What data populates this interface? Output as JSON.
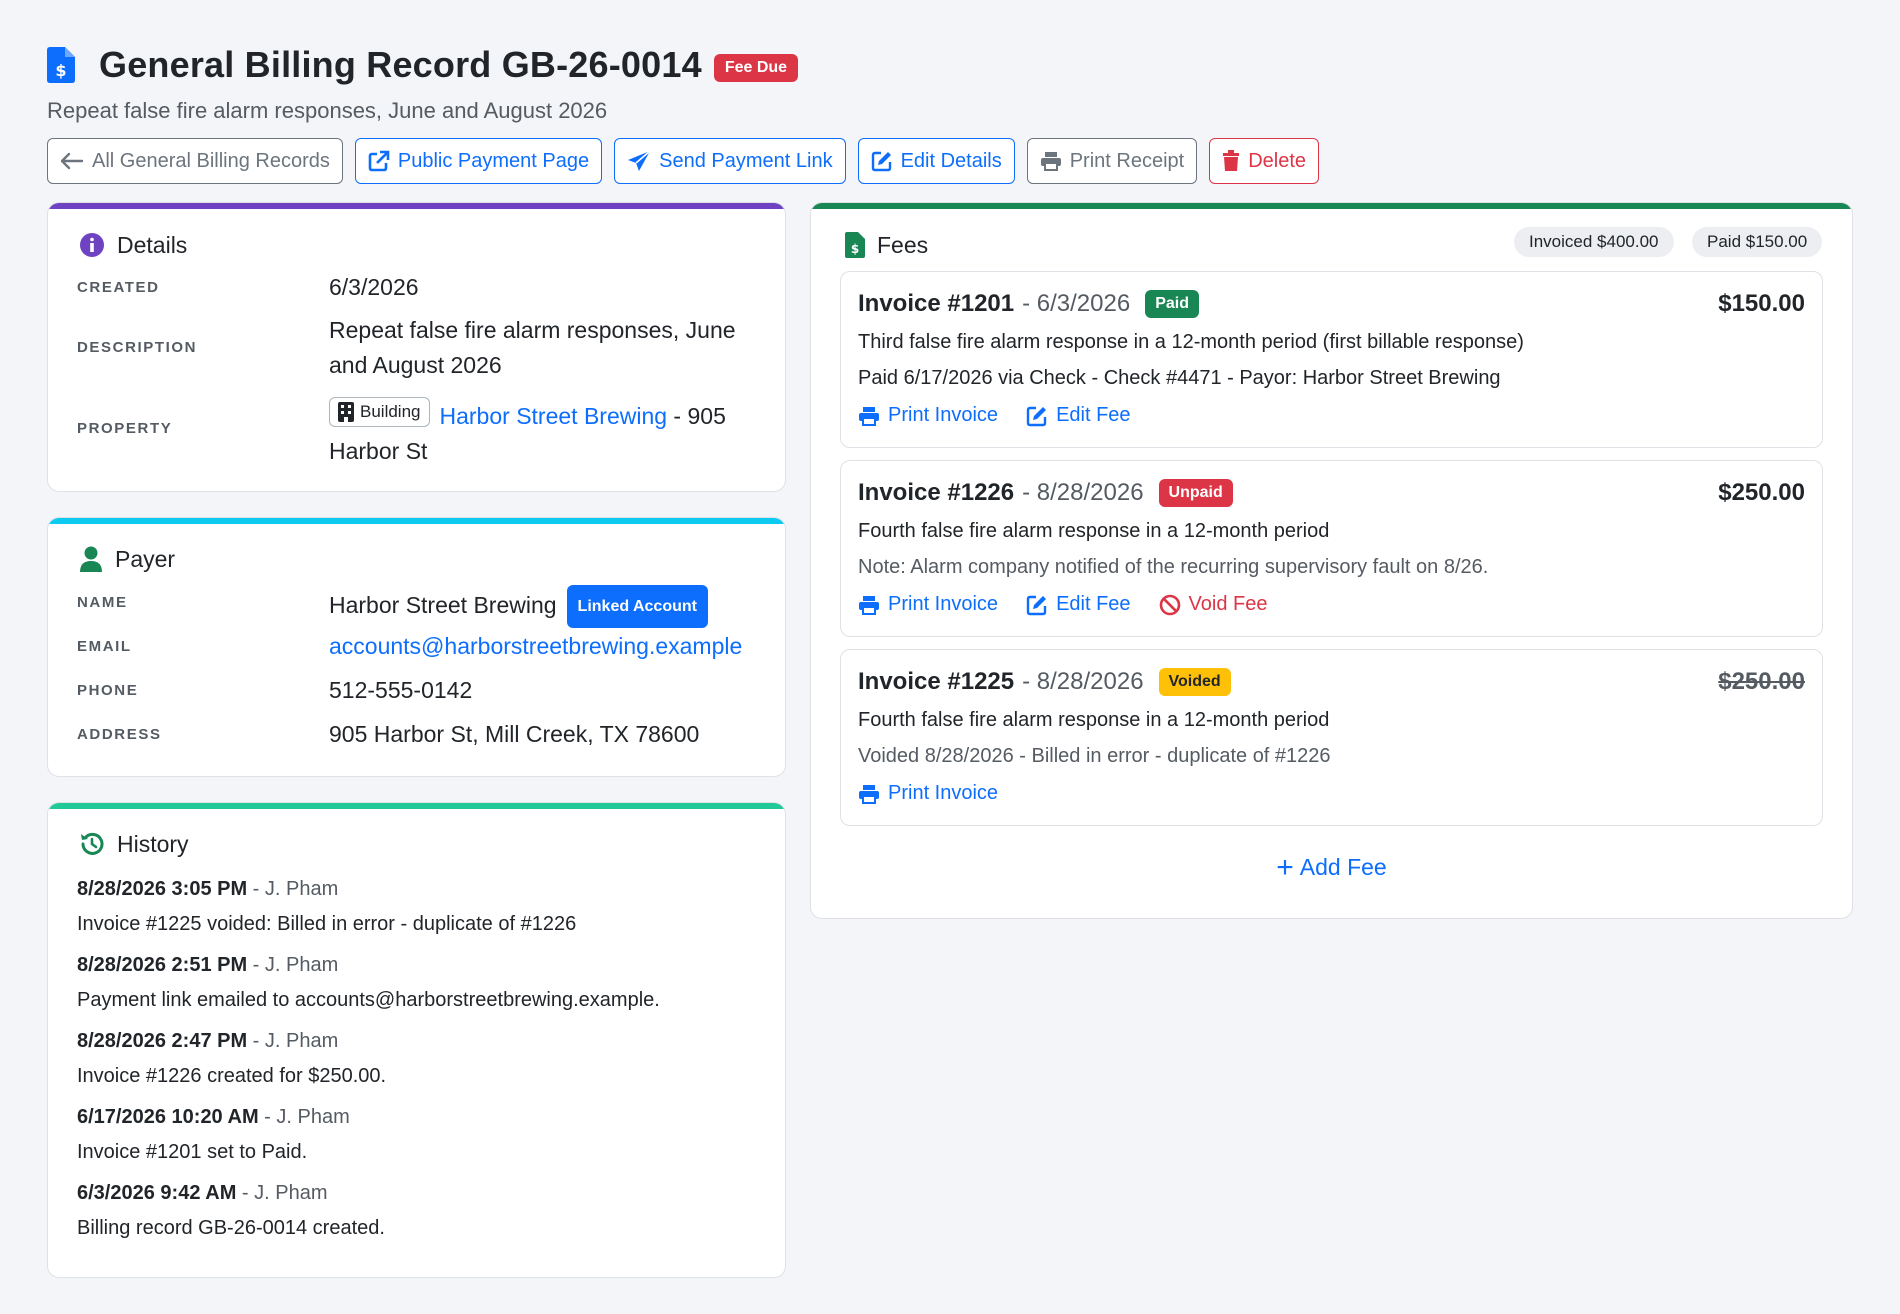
{
  "header": {
    "title": "General Billing Record GB-26-0014",
    "status_badge": "Fee Due",
    "subtitle": "Repeat false fire alarm responses, June and August 2026"
  },
  "toolbar": {
    "all_records": "All General Billing Records",
    "public_payment": "Public Payment Page",
    "send_link": "Send Payment Link",
    "edit_details": "Edit Details",
    "print_receipt": "Print Receipt",
    "delete": "Delete"
  },
  "details": {
    "title": "Details",
    "created_label": "CREATED",
    "created": "6/3/2026",
    "description_label": "DESCRIPTION",
    "description_line1": "Repeat false fire alarm responses, June",
    "description_line2": "and August 2026",
    "property_label": "PROPERTY",
    "property_type": "Building",
    "property_name": "Harbor Street Brewing",
    "property_addr_part1": " - 905",
    "property_addr_part2": "Harbor St"
  },
  "payer": {
    "title": "Payer",
    "name_label": "NAME",
    "name": "Harbor Street Brewing",
    "linked_badge": "Linked Account",
    "email_label": "EMAIL",
    "email": "accounts@harborstreetbrewing.example",
    "phone_label": "PHONE",
    "phone": "512-555-0142",
    "address_label": "ADDRESS",
    "address": "905 Harbor St, Mill Creek, TX 78600"
  },
  "history": {
    "title": "History",
    "items": [
      {
        "when": "8/28/2026 3:05 PM",
        "by": " - J. Pham",
        "text": "Invoice #1225 voided: Billed in error - duplicate of #1226"
      },
      {
        "when": "8/28/2026 2:51 PM",
        "by": " - J. Pham",
        "text": "Payment link emailed to accounts@harborstreetbrewing.example."
      },
      {
        "when": "8/28/2026 2:47 PM",
        "by": " - J. Pham",
        "text": "Invoice #1226 created for $250.00."
      },
      {
        "when": "6/17/2026 10:20 AM",
        "by": " - J. Pham",
        "text": "Invoice #1201 set to Paid."
      },
      {
        "when": "6/3/2026 9:42 AM",
        "by": " - J. Pham",
        "text": "Billing record GB-26-0014 created."
      }
    ]
  },
  "fees": {
    "title": "Fees",
    "invoiced_pill": "Invoiced $400.00",
    "paid_pill": "Paid $150.00",
    "add_fee": "Add Fee",
    "print_invoice": "Print Invoice",
    "edit_fee": "Edit Fee",
    "void_fee": "Void Fee",
    "items": [
      {
        "number": "Invoice #1201",
        "date": " - 6/3/2026",
        "status": "Paid",
        "amount": "$150.00",
        "description": "Third false fire alarm response in a 12-month period (first billable response)",
        "note": "Paid 6/17/2026 via Check - Check #4471 - Payor: Harbor Street Brewing"
      },
      {
        "number": "Invoice #1226",
        "date": " - 8/28/2026",
        "status": "Unpaid",
        "amount": "$250.00",
        "description": "Fourth false fire alarm response in a 12-month period",
        "note": "Note: Alarm company notified of the recurring supervisory fault on 8/26."
      },
      {
        "number": "Invoice #1225",
        "date": " - 8/28/2026",
        "status": "Voided",
        "amount": "$250.00",
        "description": "Fourth false fire alarm response in a 12-month period",
        "note": "Voided 8/28/2026 - Billed in error - duplicate of #1226"
      }
    ]
  },
  "colors": {
    "primary": "#0d6efd",
    "danger": "#dc3545",
    "success": "#198754",
    "warning": "#ffc107",
    "details_accent": "#6f42c1",
    "payer_accent": "#0dcaf0",
    "history_accent": "#20c997",
    "fees_accent": "#198754"
  }
}
